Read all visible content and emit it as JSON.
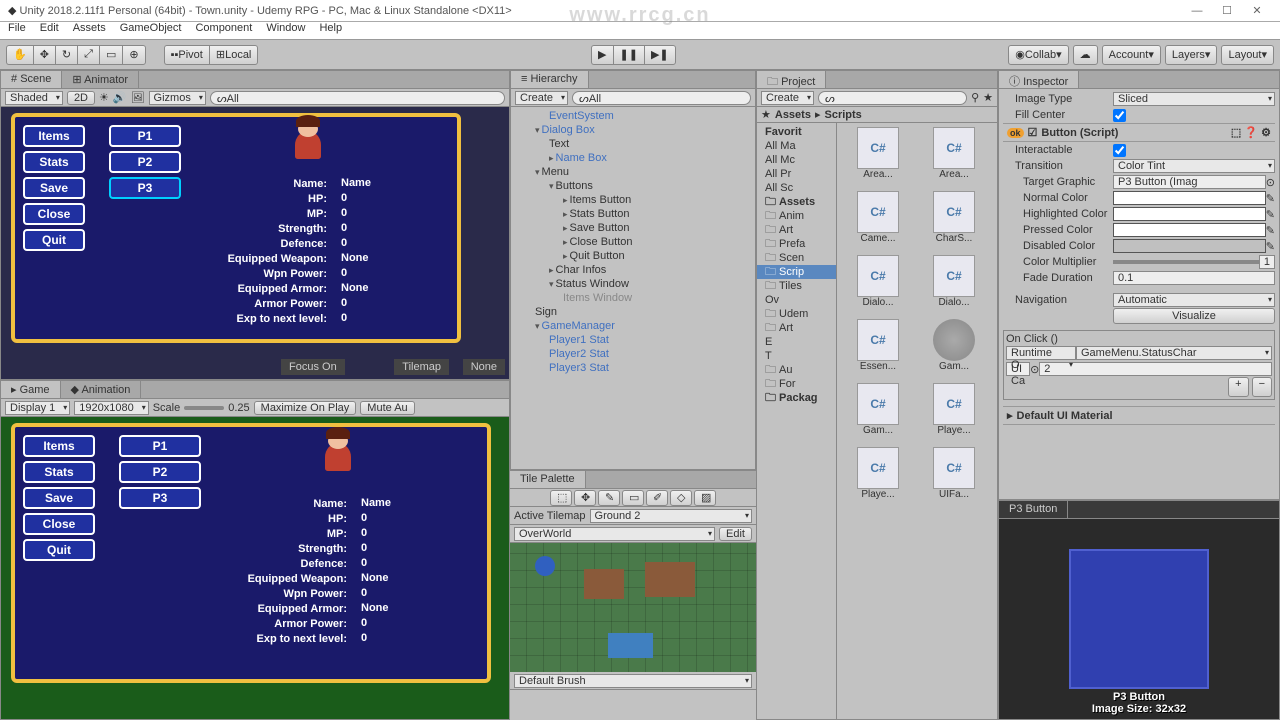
{
  "window": {
    "title": "Unity 2018.2.11f1 Personal (64bit) - Town.unity - Udemy RPG - PC, Mac & Linux Standalone <DX11>",
    "watermark": "www.rrcg.cn"
  },
  "menubar": [
    "File",
    "Edit",
    "Assets",
    "GameObject",
    "Component",
    "Window",
    "Help"
  ],
  "toolbar": {
    "pivot": "Pivot",
    "local": "Local",
    "collab": "Collab",
    "account": "Account",
    "layers": "Layers",
    "layout": "Layout"
  },
  "scene": {
    "tab_scene": "Scene",
    "tab_animator": "Animator",
    "shading": "Shaded",
    "mode2d": "2D",
    "gizmos": "Gizmos",
    "search": "All",
    "focus": "Focus On",
    "tilemap": "Tilemap",
    "none": "None"
  },
  "game": {
    "tab_game": "Game",
    "tab_animation": "Animation",
    "display": "Display 1",
    "res": "1920x1080",
    "scale_lbl": "Scale",
    "scale_val": "0.25",
    "maximize": "Maximize On Play",
    "mute": "Mute Au"
  },
  "rpg": {
    "menu": [
      "Items",
      "Stats",
      "Save",
      "Close",
      "Quit"
    ],
    "players": [
      "P1",
      "P2",
      "P3"
    ],
    "stats": [
      {
        "k": "Name:",
        "v": "Name"
      },
      {
        "k": "HP:",
        "v": "0"
      },
      {
        "k": "MP:",
        "v": "0"
      },
      {
        "k": "Strength:",
        "v": "0"
      },
      {
        "k": "Defence:",
        "v": "0"
      },
      {
        "k": "Equipped Weapon:",
        "v": "None"
      },
      {
        "k": "Wpn Power:",
        "v": "0"
      },
      {
        "k": "Equipped Armor:",
        "v": "None"
      },
      {
        "k": "Armor Power:",
        "v": "0"
      },
      {
        "k": "Exp to next level:",
        "v": "0"
      }
    ]
  },
  "hierarchy": {
    "tab": "Hierarchy",
    "create": "Create",
    "search": "All",
    "items": [
      {
        "t": "EventSystem",
        "cls": "h-blue",
        "ind": 2
      },
      {
        "t": "Dialog Box",
        "cls": "h-blue carrot open",
        "ind": 1
      },
      {
        "t": "Text",
        "cls": "",
        "ind": 2
      },
      {
        "t": "Name Box",
        "cls": "h-blue carrot",
        "ind": 2
      },
      {
        "t": "Menu",
        "cls": "carrot open",
        "ind": 1
      },
      {
        "t": "Buttons",
        "cls": "carrot open",
        "ind": 2
      },
      {
        "t": "Items Button",
        "cls": "carrot",
        "ind": 3
      },
      {
        "t": "Stats Button",
        "cls": "carrot",
        "ind": 3
      },
      {
        "t": "Save Button",
        "cls": "carrot",
        "ind": 3
      },
      {
        "t": "Close Button",
        "cls": "carrot",
        "ind": 3
      },
      {
        "t": "Quit Button",
        "cls": "carrot",
        "ind": 3
      },
      {
        "t": "Char Infos",
        "cls": "carrot",
        "ind": 2
      },
      {
        "t": "Status Window",
        "cls": "carrot open",
        "ind": 2
      },
      {
        "t": "Items Window",
        "cls": "h-gray",
        "ind": 3
      },
      {
        "t": "Sign",
        "cls": "",
        "ind": 1
      },
      {
        "t": "GameManager",
        "cls": "h-blue carrot open",
        "ind": 1
      },
      {
        "t": "Player1 Stat",
        "cls": "h-blue",
        "ind": 2
      },
      {
        "t": "Player2 Stat",
        "cls": "h-blue",
        "ind": 2
      },
      {
        "t": "Player3 Stat",
        "cls": "h-blue",
        "ind": 2
      }
    ]
  },
  "tilepalette": {
    "tab": "Tile Palette",
    "active": "Active Tilemap",
    "map": "Ground 2",
    "world": "OverWorld",
    "edit": "Edit",
    "brush": "Default Brush"
  },
  "project": {
    "tab": "Project",
    "create": "Create",
    "bc1": "Assets",
    "bc2": "Scripts",
    "tree": [
      {
        "t": "Favorit",
        "cls": "",
        "b": true
      },
      {
        "t": "All Ma",
        "cls": ""
      },
      {
        "t": "All Mc",
        "cls": ""
      },
      {
        "t": "All Pr",
        "cls": ""
      },
      {
        "t": "All Sc",
        "cls": ""
      },
      {
        "t": "Assets",
        "cls": "folder-ico",
        "b": true
      },
      {
        "t": "Anim",
        "cls": "folder-ico"
      },
      {
        "t": "Art",
        "cls": "folder-ico"
      },
      {
        "t": "Prefa",
        "cls": "folder-ico"
      },
      {
        "t": "Scen",
        "cls": "folder-ico"
      },
      {
        "t": "Scrip",
        "cls": "folder-ico",
        "sel": true
      },
      {
        "t": "Tiles",
        "cls": "folder-ico"
      },
      {
        "t": "Ov",
        "cls": ""
      },
      {
        "t": "Udem",
        "cls": "folder-ico"
      },
      {
        "t": "Art",
        "cls": "folder-ico"
      },
      {
        "t": "E",
        "cls": ""
      },
      {
        "t": "T",
        "cls": ""
      },
      {
        "t": "Au",
        "cls": "folder-ico"
      },
      {
        "t": "For",
        "cls": "folder-ico"
      },
      {
        "t": "Packag",
        "cls": "folder-ico",
        "b": true
      }
    ],
    "assets": [
      "Area...",
      "Area...",
      "Came...",
      "CharS...",
      "Dialo...",
      "Dialo...",
      "Essen...",
      "Gam...",
      "Gam...",
      "Playe...",
      "Playe...",
      "UIFa..."
    ]
  },
  "inspector": {
    "tab": "Inspector",
    "image_type_lbl": "Image Type",
    "image_type": "Sliced",
    "fill_center": "Fill Center",
    "component": "Button (Script)",
    "interactable": "Interactable",
    "transition_lbl": "Transition",
    "transition": "Color Tint",
    "target_lbl": "Target Graphic",
    "target": "P3 Button (Imag",
    "normal": "Normal Color",
    "highlighted": "Highlighted Color",
    "pressed": "Pressed Color",
    "disabled": "Disabled Color",
    "multiplier_lbl": "Color Multiplier",
    "multiplier": "1",
    "fade_lbl": "Fade Duration",
    "fade": "0.1",
    "nav_lbl": "Navigation",
    "nav": "Automatic",
    "visualize": "Visualize",
    "onclick": "On Click ()",
    "runtime": "Runtime O",
    "func": "GameMenu.StatusChar",
    "uicanvas": "UI Ca",
    "arg": "2",
    "material": "Default UI Material",
    "preview_tab": "P3 Button",
    "preview_name": "P3 Button",
    "preview_size": "Image Size: 32x32"
  }
}
